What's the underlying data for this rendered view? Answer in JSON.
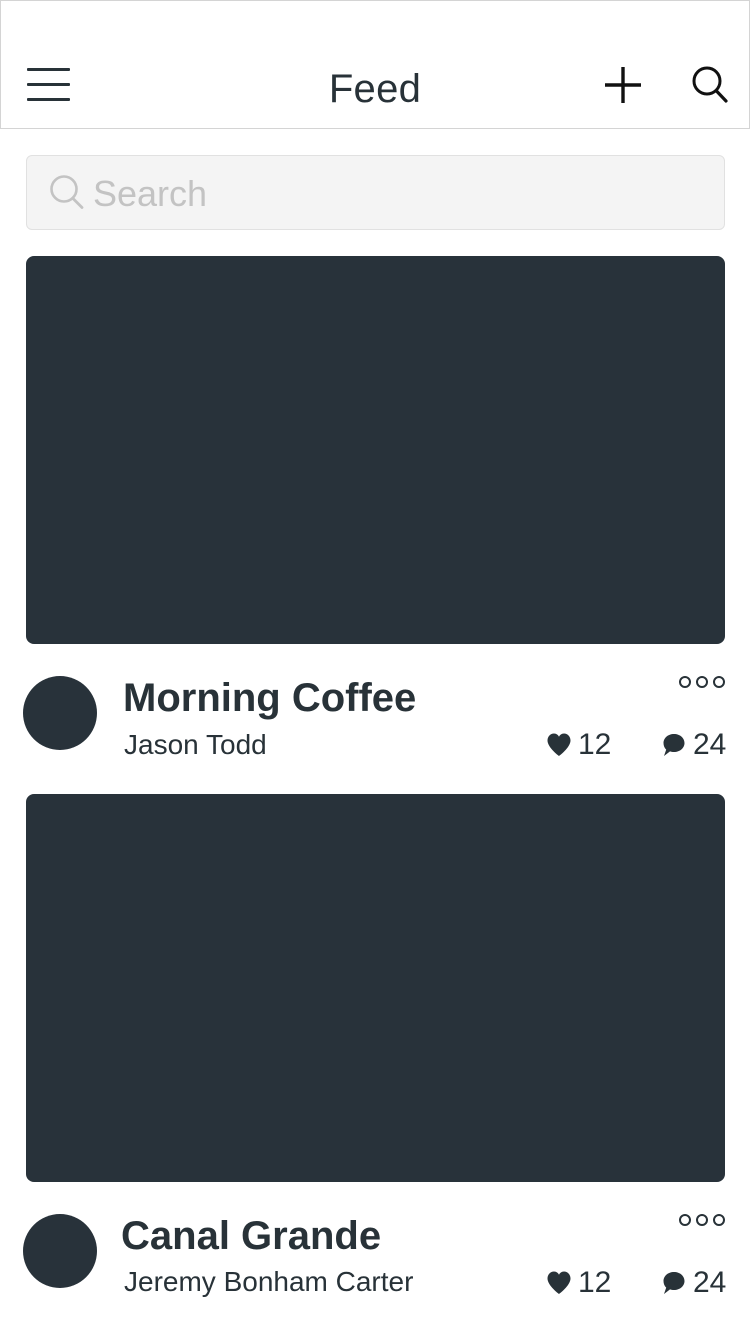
{
  "header": {
    "title": "Feed"
  },
  "search": {
    "placeholder": "Search",
    "value": ""
  },
  "posts": [
    {
      "title": "Morning Coffee",
      "author": "Jason Todd",
      "likes": "12",
      "comments": "24"
    },
    {
      "title": "Canal Grande",
      "author": "Jeremy Bonham Carter",
      "likes": "12",
      "comments": "24"
    }
  ],
  "colors": {
    "dark": "#283238",
    "placeholder": "#c3c3c3",
    "search_bg": "#f4f4f4",
    "border": "#d4d4d4"
  },
  "icons": {
    "menu": "hamburger-icon",
    "add": "plus-icon",
    "search": "search-icon",
    "more": "more-dots-icon",
    "like": "heart-icon",
    "comment": "comment-bubble-icon"
  }
}
